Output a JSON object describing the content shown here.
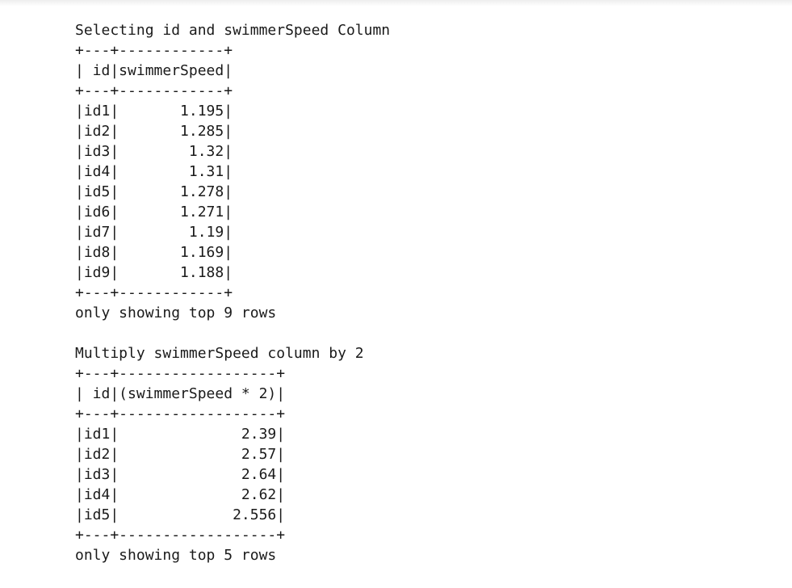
{
  "output": {
    "lines": [
      "Selecting id and swimmerSpeed Column",
      "+---+------------+",
      "| id|swimmerSpeed|",
      "+---+------------+",
      "|id1|       1.195|",
      "|id2|       1.285|",
      "|id3|        1.32|",
      "|id4|        1.31|",
      "|id5|       1.278|",
      "|id6|       1.271|",
      "|id7|        1.19|",
      "|id8|       1.169|",
      "|id9|       1.188|",
      "+---+------------+",
      "only showing top 9 rows",
      "",
      "Multiply swimmerSpeed column by 2",
      "+---+------------------+",
      "| id|(swimmerSpeed * 2)|",
      "+---+------------------+",
      "|id1|              2.39|",
      "|id2|              2.57|",
      "|id3|              2.64|",
      "|id4|              2.62|",
      "|id5|             2.556|",
      "+---+------------------+",
      "only showing top 5 rows"
    ]
  }
}
